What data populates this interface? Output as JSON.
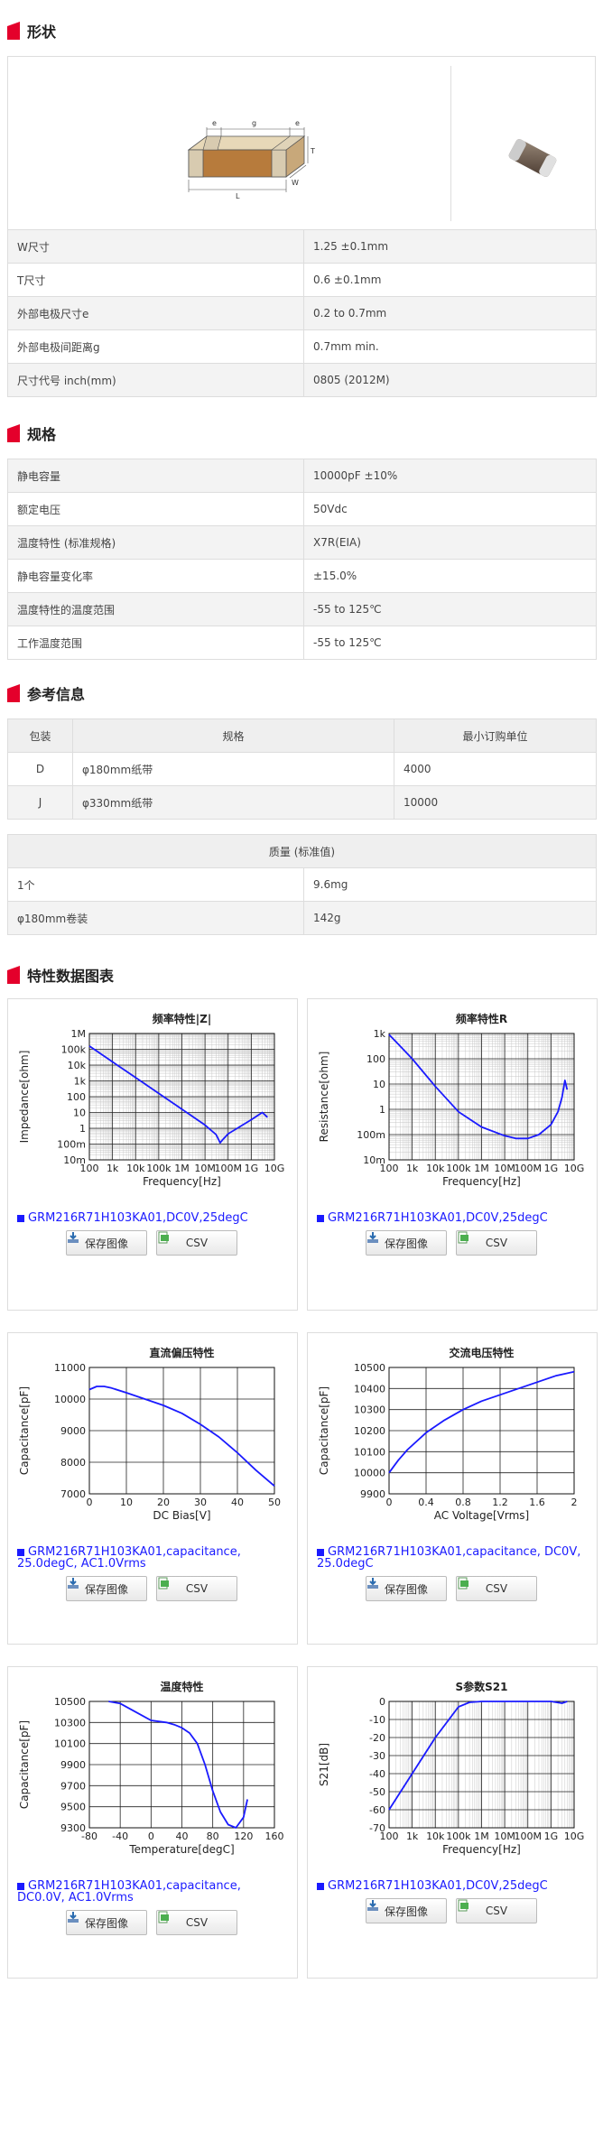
{
  "sections": {
    "shape": "形状",
    "spec": "规格",
    "reference": "参考信息",
    "charts": "特性数据图表"
  },
  "shape": {
    "dim_labels": {
      "e1": "e",
      "g": "g",
      "e2": "e",
      "T": "T",
      "L": "L",
      "W": "W"
    },
    "rows": [
      {
        "label": "W尺寸",
        "value": "1.25 ±0.1mm"
      },
      {
        "label": "T尺寸",
        "value": "0.6 ±0.1mm"
      },
      {
        "label": "外部电极尺寸e",
        "value": "0.2 to 0.7mm"
      },
      {
        "label": "外部电极间距离g",
        "value": "0.7mm min."
      },
      {
        "label": "尺寸代号 inch(mm)",
        "value": "0805 (2012M)"
      }
    ]
  },
  "spec": {
    "rows": [
      {
        "label": "静电容量",
        "value": "10000pF ±10%"
      },
      {
        "label": "额定电压",
        "value": "50Vdc"
      },
      {
        "label": "温度特性 (标准规格)",
        "value": "X7R(EIA)"
      },
      {
        "label": "静电容量变化率",
        "value": "±15.0%"
      },
      {
        "label": "温度特性的温度范围",
        "value": "-55 to 125℃"
      },
      {
        "label": "工作温度范围",
        "value": "-55 to 125℃"
      }
    ]
  },
  "reference": {
    "headers": [
      "包装",
      "规格",
      "最小订购单位"
    ],
    "rows": [
      [
        "D",
        "φ180mm纸带",
        "4000"
      ],
      [
        "J",
        "φ330mm纸带",
        "10000"
      ]
    ],
    "mass_header": "质量 (标准值)",
    "mass_rows": [
      {
        "label": "1个",
        "value": "9.6mg"
      },
      {
        "label": "φ180mm卷装",
        "value": "142g"
      }
    ]
  },
  "buttons": {
    "save": "保存图像",
    "csv": "CSV"
  },
  "colors": {
    "accent": "#e4002b",
    "series": "#1a1aff",
    "border": "#dddddd"
  },
  "chart_data": [
    {
      "type": "line",
      "title": "频率特性|Z|",
      "xlabel": "Frequency[Hz]",
      "ylabel": "Impedance[ohm]",
      "xscale": "log",
      "yscale": "log",
      "xlim": [
        100,
        10000000000
      ],
      "ylim": [
        0.01,
        1000000
      ],
      "x_ticks": [
        "100",
        "1k",
        "10k",
        "100k",
        "1M",
        "10M",
        "100M",
        "1G",
        "10G"
      ],
      "y_ticks": [
        "1M",
        "100k",
        "10k",
        "1k",
        "100",
        "10",
        "1",
        "100m",
        "10m"
      ],
      "legend": "GRM216R71H103KA01,DC0V,25degC",
      "series": [
        {
          "x": [
            100,
            1000,
            10000,
            100000,
            1000000,
            10000000,
            30000000,
            45000000,
            60000000,
            100000000,
            1000000000,
            3000000000,
            5000000000
          ],
          "y": [
            160000,
            16000,
            1600,
            160,
            16,
            1.6,
            0.4,
            0.12,
            0.2,
            0.45,
            3.5,
            10,
            5
          ]
        }
      ]
    },
    {
      "type": "line",
      "title": "频率特性R",
      "xlabel": "Frequency[Hz]",
      "ylabel": "Resistance[ohm]",
      "xscale": "log",
      "yscale": "log",
      "xlim": [
        100,
        10000000000
      ],
      "ylim": [
        0.01,
        1000
      ],
      "x_ticks": [
        "100",
        "1k",
        "10k",
        "100k",
        "1M",
        "10M",
        "100M",
        "1G",
        "10G"
      ],
      "y_ticks": [
        "1k",
        "100",
        "10",
        "1",
        "100m",
        "10m"
      ],
      "legend": "GRM216R71H103KA01,DC0V,25degC",
      "series": [
        {
          "x": [
            100,
            300,
            1000,
            10000,
            100000,
            1000000,
            10000000,
            30000000,
            100000000,
            300000000,
            1000000000,
            2000000000,
            3000000000,
            4000000000,
            5000000000
          ],
          "y": [
            900,
            320,
            100,
            8,
            0.8,
            0.2,
            0.09,
            0.07,
            0.07,
            0.1,
            0.25,
            0.8,
            3,
            14,
            6
          ]
        }
      ]
    },
    {
      "type": "line",
      "title": "直流偏压特性",
      "xlabel": "DC Bias[V]",
      "ylabel": "Capacitance[pF]",
      "xlim": [
        0,
        50
      ],
      "ylim": [
        7000,
        11000
      ],
      "x_ticks": [
        "0",
        "10",
        "20",
        "30",
        "40",
        "50"
      ],
      "y_ticks": [
        "11000",
        "10000",
        "9000",
        "8000",
        "7000"
      ],
      "legend": "GRM216R71H103KA01,capacitance, 25.0degC, AC1.0Vrms",
      "series": [
        {
          "x": [
            0,
            2,
            4,
            6,
            10,
            15,
            20,
            25,
            30,
            35,
            40,
            45,
            50
          ],
          "y": [
            10300,
            10400,
            10400,
            10350,
            10200,
            10000,
            9800,
            9550,
            9200,
            8800,
            8300,
            7750,
            7250
          ]
        }
      ]
    },
    {
      "type": "line",
      "title": "交流电压特性",
      "xlabel": "AC Voltage[Vrms]",
      "ylabel": "Capacitance[pF]",
      "xlim": [
        0,
        2
      ],
      "ylim": [
        9900,
        10500
      ],
      "x_ticks": [
        "0",
        "0.4",
        "0.8",
        "1.2",
        "1.6",
        "2"
      ],
      "y_ticks": [
        "10500",
        "10400",
        "10300",
        "10200",
        "10100",
        "10000",
        "9900"
      ],
      "legend": "GRM216R71H103KA01,capacitance, DC0V, 25.0degC",
      "series": [
        {
          "x": [
            0,
            0.05,
            0.1,
            0.2,
            0.4,
            0.6,
            0.8,
            1.0,
            1.2,
            1.4,
            1.6,
            1.8,
            2.0
          ],
          "y": [
            10000,
            10030,
            10060,
            10110,
            10190,
            10250,
            10300,
            10340,
            10370,
            10400,
            10430,
            10460,
            10480
          ]
        }
      ]
    },
    {
      "type": "line",
      "title": "温度特性",
      "xlabel": "Temperature[degC]",
      "ylabel": "Capacitance[pF]",
      "xlim": [
        -80,
        160
      ],
      "ylim": [
        9300,
        10500
      ],
      "x_ticks": [
        "-80",
        "-40",
        "0",
        "40",
        "80",
        "120",
        "160"
      ],
      "y_ticks": [
        "10500",
        "10300",
        "10100",
        "9900",
        "9700",
        "9500",
        "9300"
      ],
      "legend": "GRM216R71H103KA01,capacitance, DC0.0V, AC1.0Vrms",
      "series": [
        {
          "x": [
            -55,
            -40,
            -20,
            0,
            10,
            20,
            30,
            40,
            50,
            60,
            70,
            80,
            90,
            100,
            110,
            120,
            125
          ],
          "y": [
            10500,
            10480,
            10400,
            10320,
            10310,
            10300,
            10280,
            10250,
            10200,
            10100,
            9900,
            9650,
            9450,
            9330,
            9300,
            9400,
            9570
          ]
        }
      ]
    },
    {
      "type": "line",
      "title": "S参数S21",
      "xlabel": "Frequency[Hz]",
      "ylabel": "S21[dB]",
      "xscale": "log",
      "xlim": [
        100,
        10000000000
      ],
      "ylim": [
        -70,
        0
      ],
      "x_ticks": [
        "100",
        "1k",
        "10k",
        "100k",
        "1M",
        "10M",
        "100M",
        "1G",
        "10G"
      ],
      "y_ticks": [
        "0",
        "-10",
        "-20",
        "-30",
        "-40",
        "-50",
        "-60",
        "-70"
      ],
      "legend": "GRM216R71H103KA01,DC0V,25degC",
      "series": [
        {
          "x": [
            100,
            1000,
            10000,
            100000,
            300000,
            1000000,
            10000000,
            100000000,
            1000000000,
            3000000000,
            5000000000
          ],
          "y": [
            -60,
            -40,
            -20,
            -3,
            -0.5,
            0,
            0,
            0,
            0,
            -1,
            0
          ]
        }
      ]
    }
  ]
}
